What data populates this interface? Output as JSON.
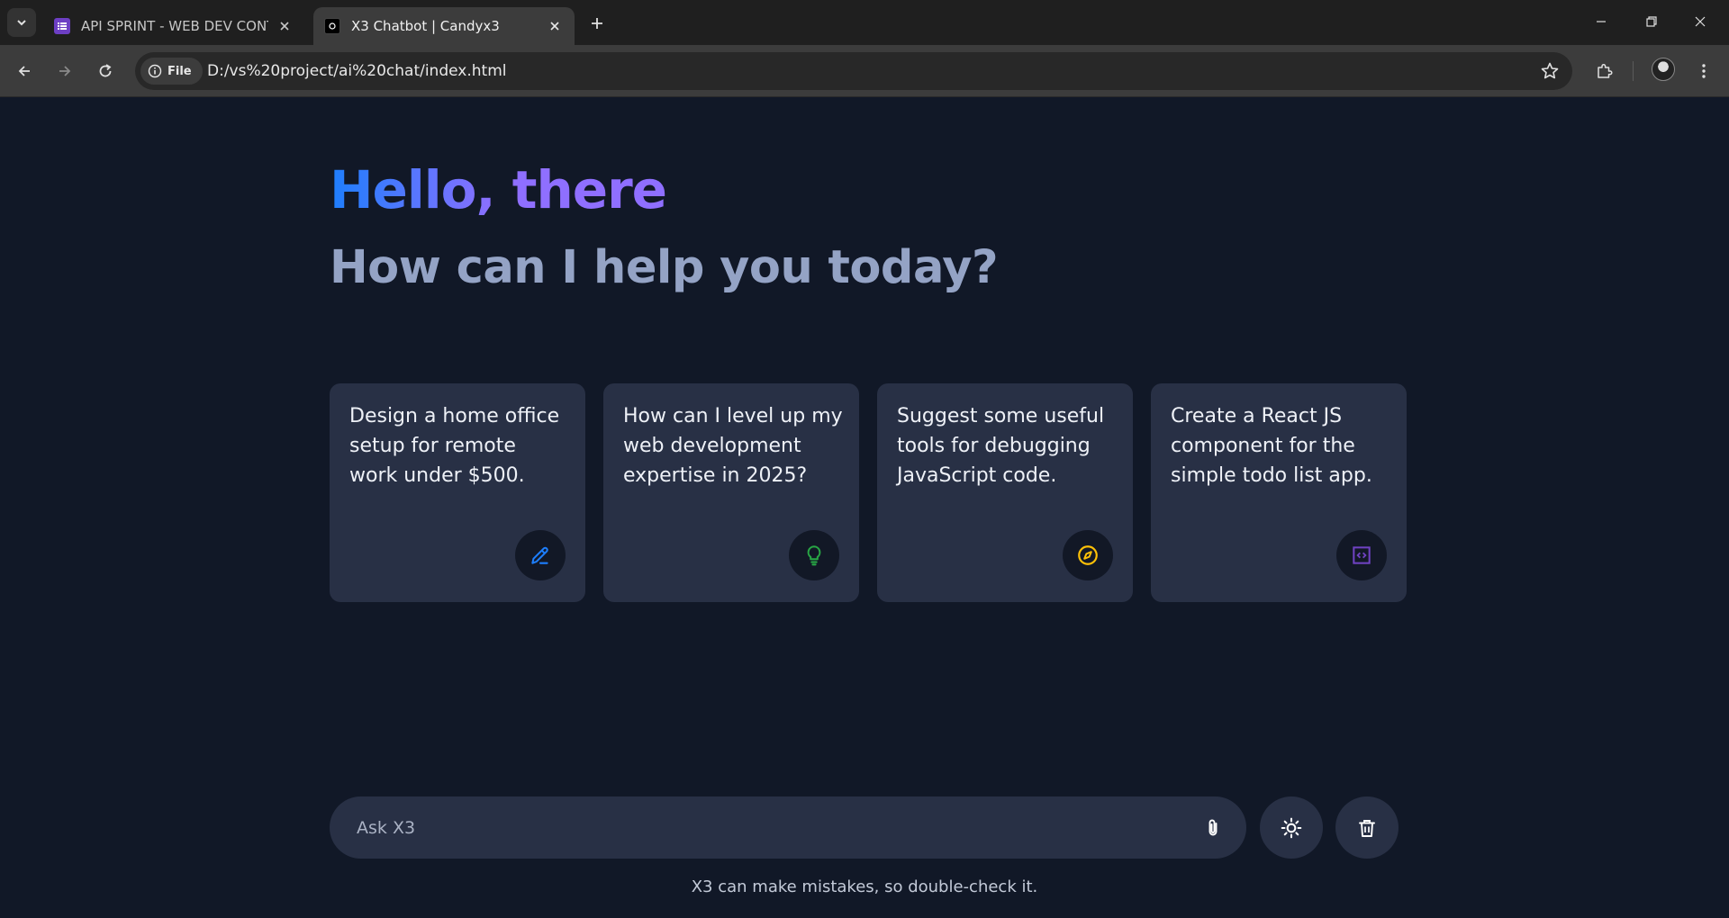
{
  "browser": {
    "tabs": [
      {
        "title": "API SPRINT - WEB DEV CONTES",
        "active": false
      },
      {
        "title": "X3 Chatbot | Candyx3",
        "active": true
      }
    ],
    "address": {
      "chip_label": "File",
      "url": "D:/vs%20project/ai%20chat/index.html"
    }
  },
  "page": {
    "greeting": "Hello, there",
    "subheading": "How can I help you today?",
    "suggestions": [
      {
        "text": "Design a home office setup for remote work under $500.",
        "icon": "edit-pen-icon",
        "icon_color": "#1d7efd"
      },
      {
        "text": "How can I level up my web development expertise in 2025?",
        "icon": "lightbulb-icon",
        "icon_color": "#28a745"
      },
      {
        "text": "Suggest some useful tools for debugging JavaScript code.",
        "icon": "compass-icon",
        "icon_color": "#ffc107"
      },
      {
        "text": "Create a React JS component for the simple todo list app.",
        "icon": "code-blocks-icon",
        "icon_color": "#6f42c1"
      }
    ],
    "prompt": {
      "placeholder": "Ask X3"
    },
    "disclaimer": "X3 can make mistakes, so double-check it."
  },
  "colors": {
    "background": "#111827",
    "card": "#283045",
    "gradient_start": "#1d7efd",
    "gradient_end": "#8f6fff",
    "subheading": "#94a3c5"
  }
}
